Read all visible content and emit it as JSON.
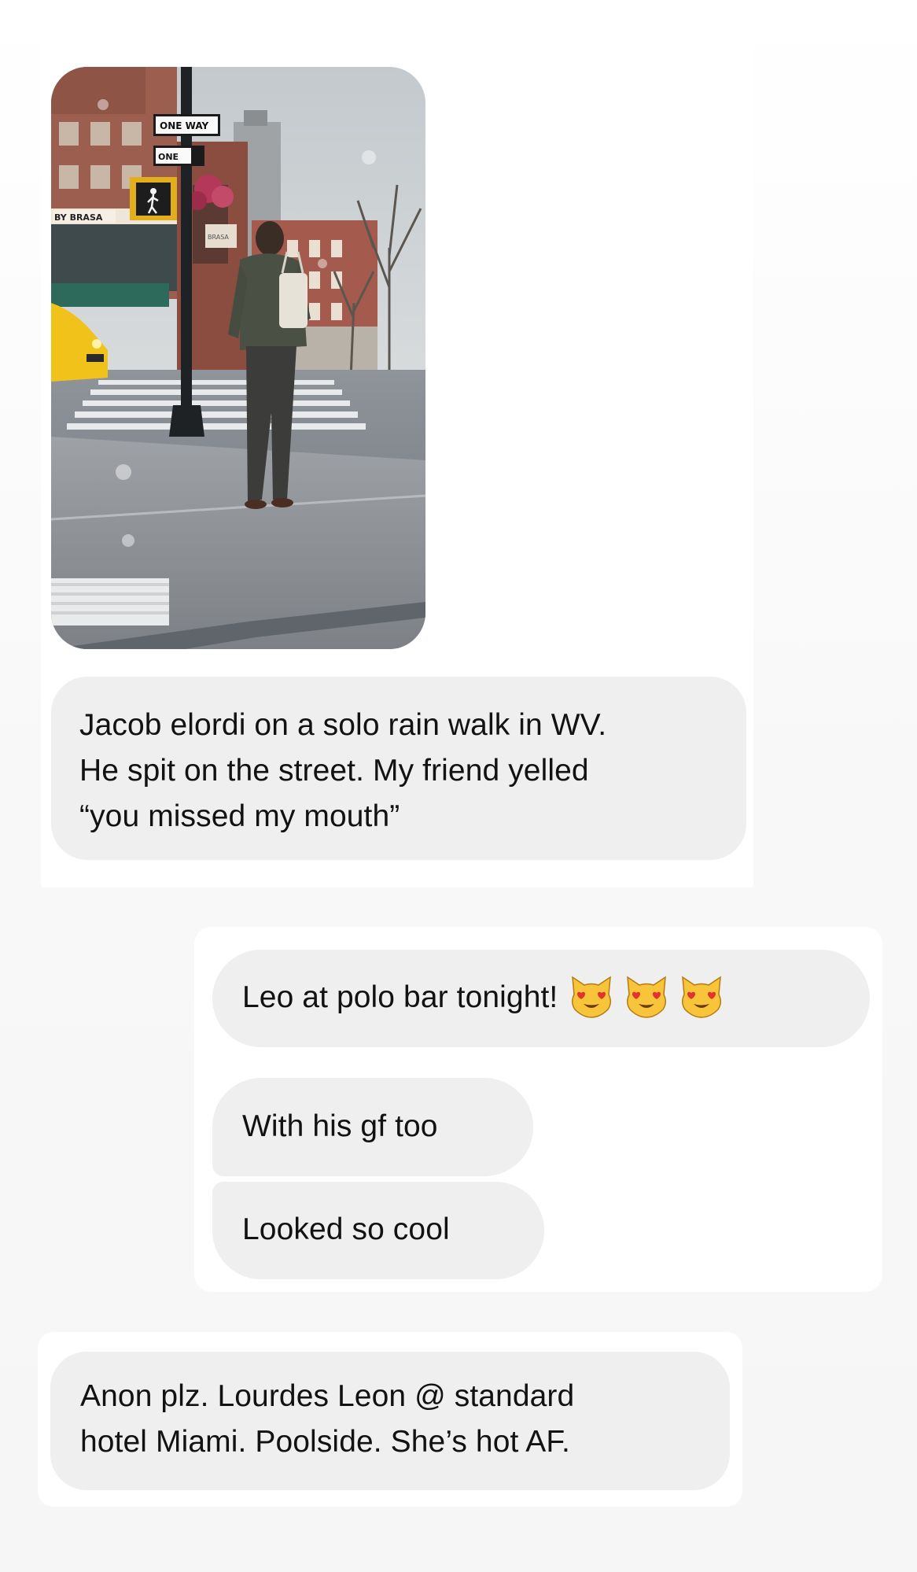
{
  "screen": {
    "background": "#f7f7f7",
    "bubble_color": "#efefef"
  },
  "messages": [
    {
      "id": "jacob",
      "photo": {
        "sign_one_way": "ONE WAY",
        "sign_one": "ONE",
        "storefront": "BY BRASA",
        "awning_sign": "BRASA"
      },
      "lines": [
        "Jacob elordi on a solo rain walk in WV.",
        "He spit on the street. My friend yelled",
        "“you missed my mouth”"
      ]
    },
    {
      "id": "leo",
      "bubbles": [
        {
          "text": "Leo at polo bar tonight!",
          "emojis": [
            "heart-eyes-cat-icon",
            "heart-eyes-cat-icon",
            "heart-eyes-cat-icon"
          ]
        },
        {
          "text": "With his gf too"
        },
        {
          "text": "Looked so cool"
        }
      ]
    },
    {
      "id": "lourdes",
      "lines": [
        "Anon plz. Lourdes Leon @ standard",
        "hotel Miami. Poolside. She’s hot AF."
      ]
    }
  ]
}
